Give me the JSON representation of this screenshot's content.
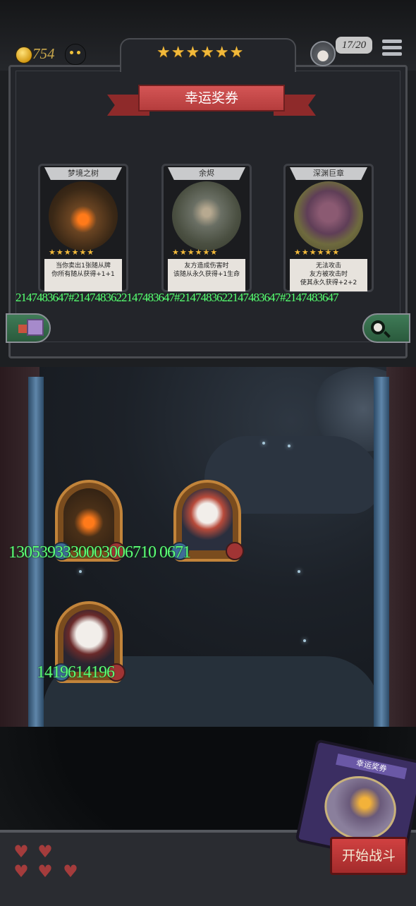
{
  "top_bar": {
    "coins": "754",
    "tier_stars": "★★★★★★",
    "player_count": "17/20",
    "menu_icon": "hamburger-menu-icon"
  },
  "shop": {
    "banner_title": "幸运奖券",
    "cards": [
      {
        "name": "梦境之树",
        "stars": "★★★★★★",
        "desc_line1": "当你卖出1张随从牌",
        "desc_line2": "你所有随从获得+1+1",
        "desc_line3": ""
      },
      {
        "name": "余烬",
        "stars": "★★★★★★",
        "desc_line1": "友方造成伤害时",
        "desc_line2": "该随从永久获得+1生命",
        "desc_line3": ""
      },
      {
        "name": "深渊巨章",
        "stars": "★★★★★★",
        "desc_line1": "无法攻击",
        "desc_line2": "友方被攻击时",
        "desc_line3": "使其永久获得+2+2"
      }
    ],
    "stat_overlay": "2147483647#2147483622147483647#2147483622147483647#2147483647"
  },
  "board": {
    "units": [
      {
        "name": "tree-unit"
      },
      {
        "name": "bunny-unit"
      },
      {
        "name": "mask-unit"
      }
    ],
    "row1_stat": "1305393330003006710 0671",
    "row2_stat": "1419614196"
  },
  "bottom": {
    "hearts": [
      "full",
      "full",
      "full",
      "full",
      "full"
    ],
    "ticket_title": "幸运奖券",
    "start_button": "开始战斗"
  },
  "colors": {
    "accent_red": "#b53d3d",
    "stat_green": "#5cff77",
    "gold": "#f2b93a"
  }
}
